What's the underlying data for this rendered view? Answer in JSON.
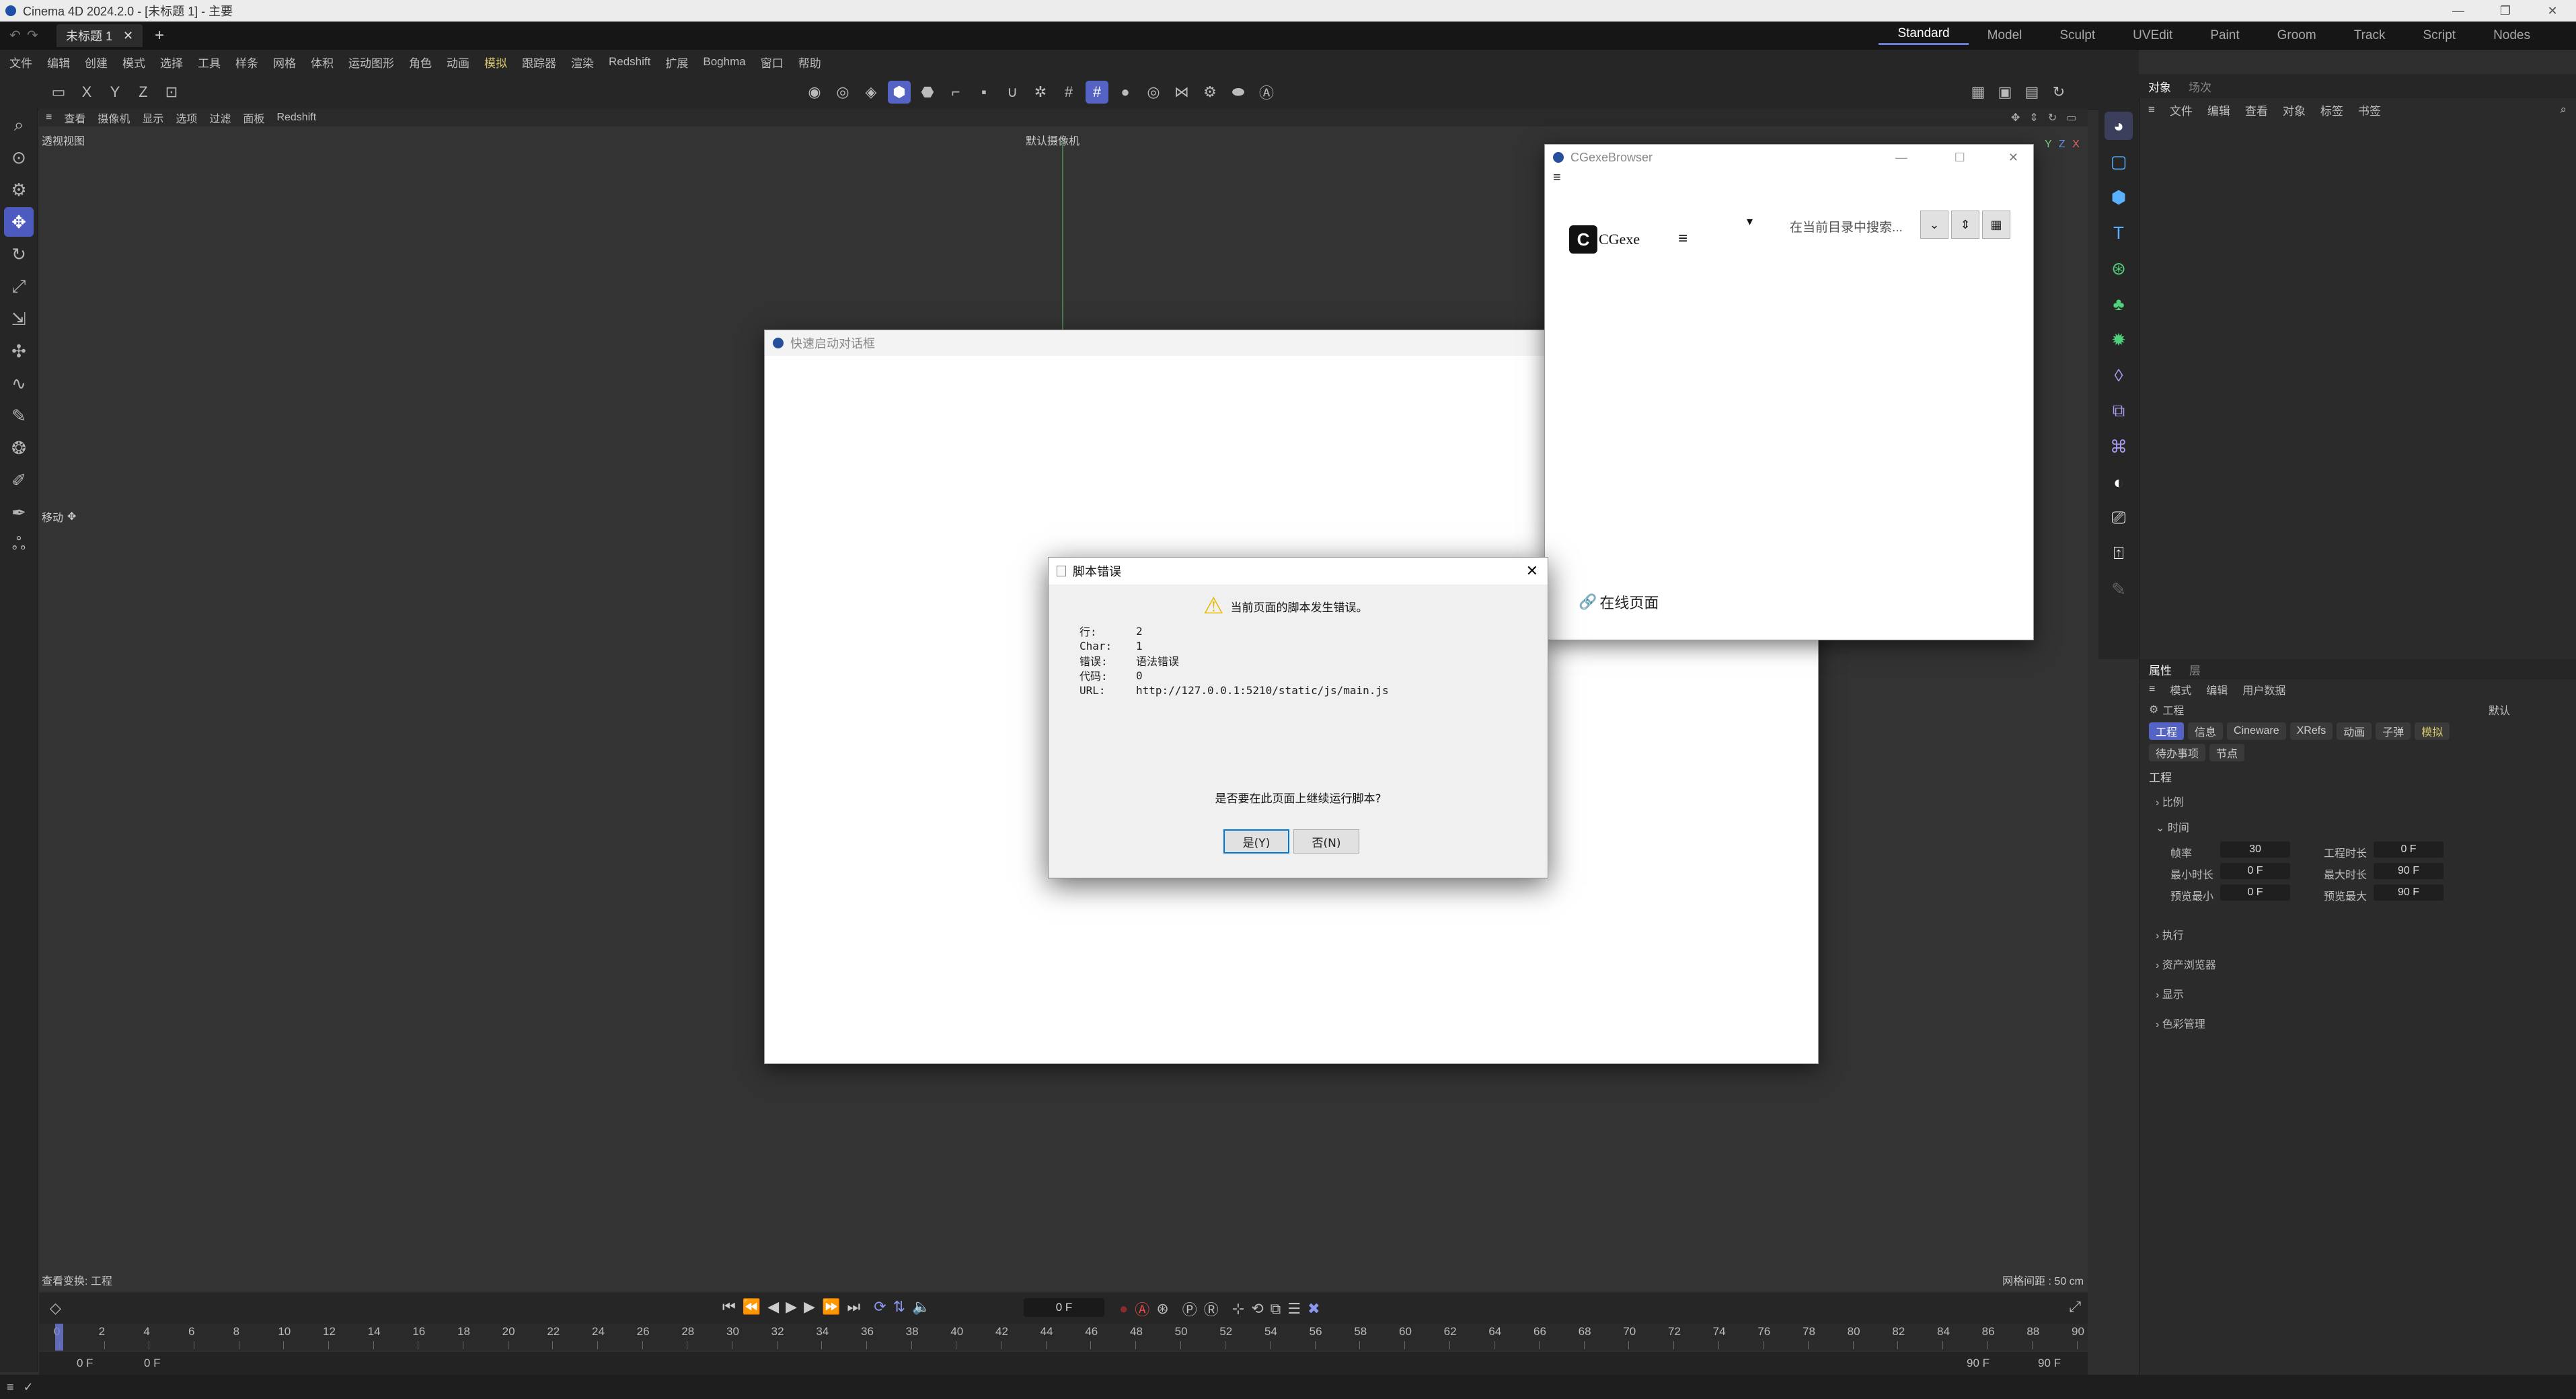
{
  "app": {
    "title": "Cinema 4D 2024.2.0 - [未标题 1] - 主要",
    "doc_tab": "未标题 1",
    "window_controls": [
      "—",
      "❐",
      "✕"
    ]
  },
  "layouts": [
    "Standard",
    "Model",
    "Sculpt",
    "UVEdit",
    "Paint",
    "Groom",
    "Track",
    "Script",
    "Nodes"
  ],
  "menu": [
    "文件",
    "编辑",
    "创建",
    "模式",
    "选择",
    "工具",
    "样条",
    "网格",
    "体积",
    "运动图形",
    "角色",
    "动画",
    "模拟",
    "跟踪器",
    "渲染",
    "Redshift",
    "扩展",
    "Boghma",
    "窗口",
    "帮助"
  ],
  "viewport": {
    "menu": [
      "查看",
      "摄像机",
      "显示",
      "选项",
      "过滤",
      "面板",
      "Redshift"
    ],
    "label": "透视视图",
    "camera": "默认摄像机",
    "move_label": "移动",
    "status_left": "查看变换: 工程",
    "status_right": "网格间距 : 50 cm"
  },
  "timeline": {
    "current_frame": "0 F",
    "ticks": [
      "0",
      "2",
      "4",
      "6",
      "8",
      "10",
      "12",
      "14",
      "16",
      "18",
      "20",
      "22",
      "24",
      "26",
      "28",
      "30",
      "32",
      "34",
      "36",
      "38",
      "40",
      "42",
      "44",
      "46",
      "48",
      "50",
      "52",
      "54",
      "56",
      "58",
      "60",
      "62",
      "64",
      "66",
      "68",
      "70",
      "72",
      "74",
      "76",
      "78",
      "80",
      "82",
      "84",
      "86",
      "88",
      "90"
    ],
    "range_start": "0 F",
    "range_start2": "0 F",
    "range_end": "90 F",
    "range_end2": "90 F"
  },
  "objects_panel": {
    "tabs": [
      "对象",
      "场次"
    ],
    "menu": [
      "文件",
      "编辑",
      "查看",
      "对象",
      "标签",
      "书签"
    ]
  },
  "attributes_panel": {
    "tabs": [
      "属性",
      "层"
    ],
    "menu": [
      "模式",
      "编辑",
      "用户数据"
    ],
    "breadcrumb": "工程",
    "preset": "默认",
    "chips_row1": [
      "工程",
      "信息",
      "Cineware",
      "XRefs",
      "动画",
      "子弹",
      "模拟"
    ],
    "chips_row2": [
      "待办事项",
      "节点"
    ],
    "section": "工程",
    "groups": [
      "比例",
      "时间",
      "执行",
      "资产浏览器",
      "显示",
      "色彩管理"
    ],
    "fields": {
      "fps_label": "帧率",
      "fps": "30",
      "project_time_label": "工程时长",
      "project_time": "0 F",
      "min_time_label": "最小时长",
      "min_time": "0 F",
      "max_time_label": "最大时长",
      "max_time": "90 F",
      "preview_min_label": "预览最小",
      "preview_min": "0 F",
      "preview_max_label": "预览最大",
      "preview_max": "90 F"
    }
  },
  "quick_launch": {
    "title": "快速启动对话框"
  },
  "browser": {
    "title": "CGexeBrowser",
    "logo": "CGexe",
    "search_placeholder": "在当前目录中搜索...",
    "online_link": "在线页面"
  },
  "script_error": {
    "title": "脚本错误",
    "message": "当前页面的脚本发生错误。",
    "rows": [
      {
        "k": "行:",
        "v": "2"
      },
      {
        "k": "Char:",
        "v": "1"
      },
      {
        "k": "错误:",
        "v": "语法错误"
      },
      {
        "k": "代码:",
        "v": "0"
      },
      {
        "k": "URL:",
        "v": "http://127.0.0.1:5210/static/js/main.js"
      }
    ],
    "question": "是否要在此页面上继续运行脚本?",
    "yes": "是(Y)",
    "no": "否(N)"
  }
}
